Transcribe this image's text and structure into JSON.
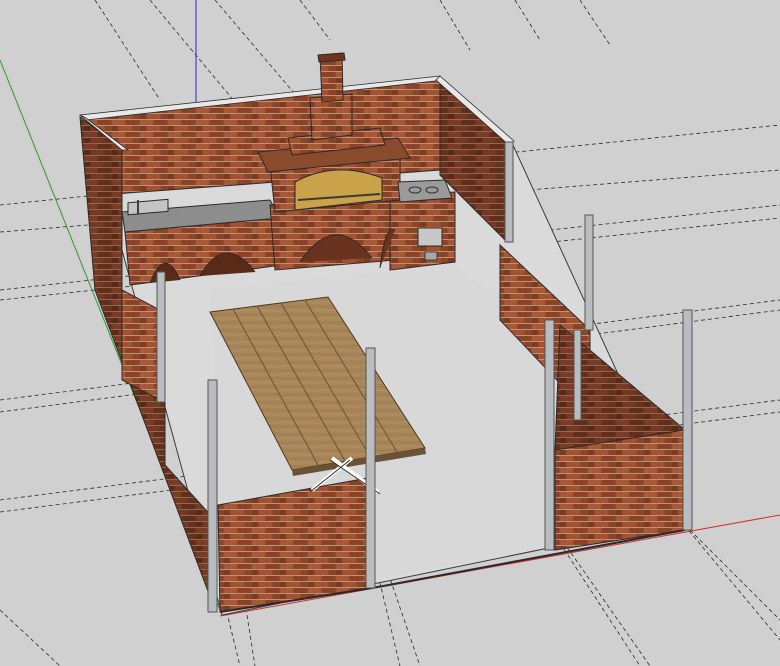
{
  "viewport": {
    "background_color": "#d0d0d0",
    "floor_color": "#d6d6d6",
    "inner_floor_color": "#dadada"
  },
  "colors": {
    "brick": "#9a4a2c",
    "brick_dark": "#6e3420",
    "mortar": "#b08e72",
    "steel": "#b9bcc0",
    "steel_dark": "#8c8f93",
    "wood": "#a8865a",
    "wood_dark": "#6b5236",
    "counter": "#8d8d8d",
    "axis_red": "#d03030",
    "axis_green": "#2e9a2e",
    "axis_blue": "#2a2ad0",
    "guide_line": "#2a2a2a"
  },
  "model": {
    "walls": [
      "back-wall",
      "left-wall",
      "right-wall",
      "front-left-wall",
      "front-right-wall",
      "inner-right-wall"
    ],
    "posts": [
      "post-1",
      "post-2",
      "post-3",
      "post-4",
      "post-5",
      "post-6",
      "post-7",
      "post-8"
    ],
    "elements": [
      "bbq-oven",
      "chimney",
      "sink",
      "stove-cooktop",
      "kitchen-counter",
      "dining-table",
      "table-x-legs",
      "floor-slab"
    ]
  }
}
